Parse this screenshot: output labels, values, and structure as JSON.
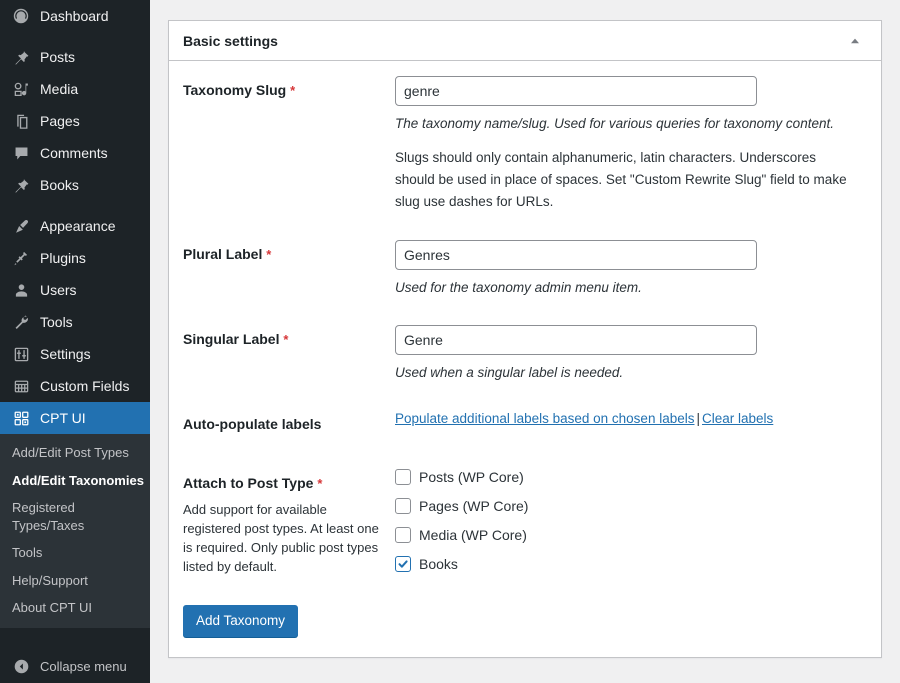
{
  "sidebar": {
    "items": [
      {
        "label": "Dashboard",
        "icon": "dashboard-icon",
        "key": "dashboard"
      },
      {
        "label": "Posts",
        "icon": "pin-icon",
        "key": "posts"
      },
      {
        "label": "Media",
        "icon": "media-icon",
        "key": "media"
      },
      {
        "label": "Pages",
        "icon": "pages-icon",
        "key": "pages"
      },
      {
        "label": "Comments",
        "icon": "comments-icon",
        "key": "comments"
      },
      {
        "label": "Books",
        "icon": "pin-icon",
        "key": "books"
      },
      {
        "label": "Appearance",
        "icon": "brush-icon",
        "key": "appearance"
      },
      {
        "label": "Plugins",
        "icon": "plug-icon",
        "key": "plugins"
      },
      {
        "label": "Users",
        "icon": "user-icon",
        "key": "users"
      },
      {
        "label": "Tools",
        "icon": "wrench-icon",
        "key": "tools"
      },
      {
        "label": "Settings",
        "icon": "sliders-icon",
        "key": "settings"
      },
      {
        "label": "Custom Fields",
        "icon": "grid-table-icon",
        "key": "custom-fields"
      },
      {
        "label": "CPT UI",
        "icon": "blocks-icon",
        "key": "cpt-ui"
      }
    ],
    "current_key": "cpt-ui",
    "submenu": [
      {
        "label": "Add/Edit Post Types",
        "current": false
      },
      {
        "label": "Add/Edit Taxonomies",
        "current": true
      },
      {
        "label": "Registered Types/Taxes",
        "current": false
      },
      {
        "label": "Tools",
        "current": false
      },
      {
        "label": "Help/Support",
        "current": false
      },
      {
        "label": "About CPT UI",
        "current": false
      }
    ],
    "collapse_label": "Collapse menu"
  },
  "panel": {
    "title": "Basic settings",
    "toggle_icon": "chevron-up-icon"
  },
  "form": {
    "required_marker": "*",
    "taxonomy_slug": {
      "label": "Taxonomy Slug",
      "value": "genre",
      "placeholder": "",
      "desc": "The taxonomy name/slug. Used for various queries for taxonomy content.",
      "desc_extra": "Slugs should only contain alphanumeric, latin characters. Underscores should be used in place of spaces. Set \"Custom Rewrite Slug\" field to make slug use dashes for URLs."
    },
    "plural_label": {
      "label": "Plural Label",
      "value": "Genres",
      "placeholder": "",
      "desc": "Used for the taxonomy admin menu item."
    },
    "singular_label": {
      "label": "Singular Label",
      "value": "Genre",
      "placeholder": "",
      "desc": "Used when a singular label is needed."
    },
    "auto_populate": {
      "label": "Auto-populate labels",
      "populate_link": "Populate additional labels based on chosen labels",
      "separator": "|",
      "clear_link": "Clear labels"
    },
    "attach_to_post_type": {
      "label": "Attach to Post Type",
      "desc": "Add support for available registered post types. At least one is required. Only public post types listed by default.",
      "options": [
        {
          "label": "Posts (WP Core)",
          "checked": false
        },
        {
          "label": "Pages (WP Core)",
          "checked": false
        },
        {
          "label": "Media (WP Core)",
          "checked": false
        },
        {
          "label": "Books",
          "checked": true
        }
      ]
    },
    "submit_label": "Add Taxonomy"
  },
  "colors": {
    "accent": "#2271b1",
    "sidebar_bg": "#1d2327",
    "submenu_bg": "#2c3338",
    "required": "#d63638",
    "page_bg": "#f0f0f1"
  }
}
